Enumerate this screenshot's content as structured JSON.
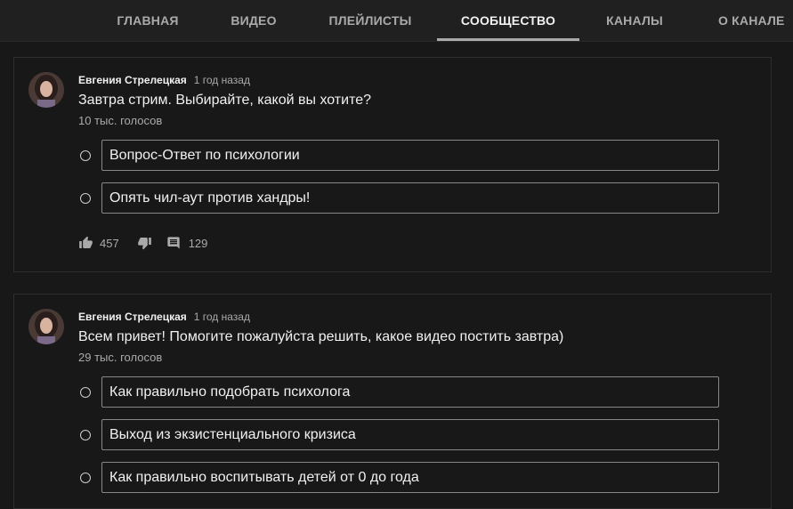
{
  "tabs": [
    {
      "label": "ГЛАВНАЯ"
    },
    {
      "label": "ВИДЕО"
    },
    {
      "label": "ПЛЕЙЛИСТЫ"
    },
    {
      "label": "СООБЩЕСТВО",
      "active": true
    },
    {
      "label": "КАНАЛЫ"
    },
    {
      "label": "О КАНАЛЕ"
    }
  ],
  "posts": [
    {
      "author": "Евгения Стрелецкая",
      "time": "1 год назад",
      "text": "Завтра стрим. Выбирайте, какой вы хотите?",
      "votes": "10 тыс. голосов",
      "options": [
        "Вопрос-Ответ по психологии",
        "Опять чил-аут против хандры!"
      ],
      "likes": "457",
      "comments": "129"
    },
    {
      "author": "Евгения Стрелецкая",
      "time": "1 год назад",
      "text": "Всем привет! Помогите пожалуйста решить, какое видео постить завтра)",
      "votes": "29 тыс. голосов",
      "options": [
        "Как правильно подобрать психолога",
        "Выход из экзистенциального кризиса",
        "Как правильно воспитывать детей от 0 до года"
      ]
    }
  ],
  "icons": {
    "like": "thumb-up-icon",
    "dislike": "thumb-down-icon",
    "comment": "comment-icon",
    "radio": "radio-button-icon"
  },
  "colors": {
    "background": "#181818",
    "tabbar": "#202020",
    "text": "#f1f1f1",
    "secondary": "#aaaaaa",
    "option_border": "#888888"
  }
}
